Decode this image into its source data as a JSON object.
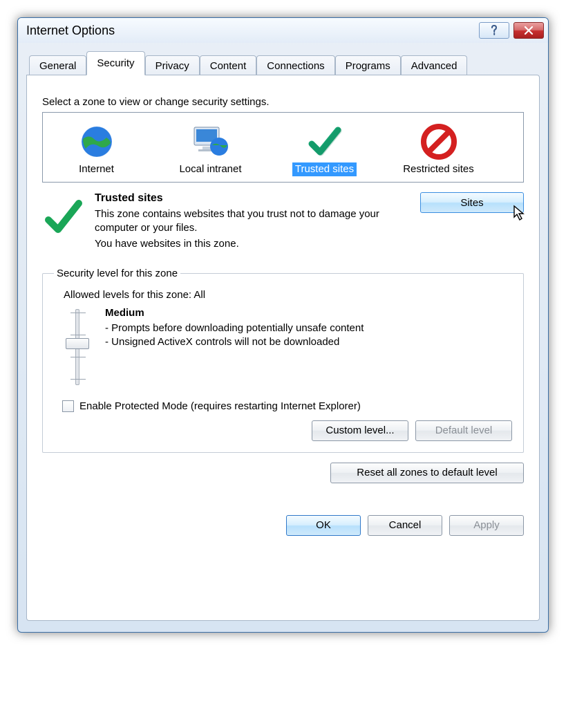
{
  "window": {
    "title": "Internet Options"
  },
  "tabs": [
    "General",
    "Security",
    "Privacy",
    "Content",
    "Connections",
    "Programs",
    "Advanced"
  ],
  "activeTab": "Security",
  "instruction": "Select a zone to view or change security settings.",
  "zones": {
    "internet": "Internet",
    "localIntranet": "Local intranet",
    "trustedSites": "Trusted sites",
    "restrictedSites": "Restricted sites"
  },
  "selectedZone": "trustedSites",
  "zoneDetail": {
    "heading": "Trusted sites",
    "desc": "This zone contains websites that you trust not to damage your computer or your files.",
    "status": "You have websites in this zone.",
    "sitesButton": "Sites"
  },
  "securityLevel": {
    "legend": "Security level for this zone",
    "allowed": "Allowed levels for this zone: All",
    "levelName": "Medium",
    "bullet1": "- Prompts before downloading potentially unsafe content",
    "bullet2": "- Unsigned ActiveX controls will not be downloaded",
    "protectedMode": "Enable Protected Mode (requires restarting Internet Explorer)",
    "protectedModeChecked": false,
    "customLevel": "Custom level...",
    "defaultLevel": "Default level",
    "defaultLevelEnabled": false
  },
  "resetButton": "Reset all zones to default level",
  "footer": {
    "ok": "OK",
    "cancel": "Cancel",
    "apply": "Apply",
    "applyEnabled": false
  }
}
